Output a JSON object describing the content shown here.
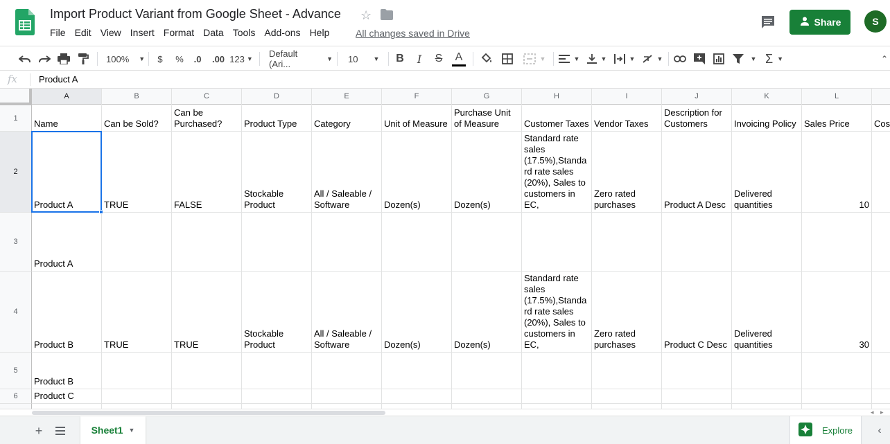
{
  "doc": {
    "title": "Import Product Variant from Google Sheet - Advance",
    "saved_status": "All changes saved in Drive"
  },
  "menus": [
    "File",
    "Edit",
    "View",
    "Insert",
    "Format",
    "Data",
    "Tools",
    "Add-ons",
    "Help"
  ],
  "header": {
    "share_label": "Share",
    "avatar_letter": "S"
  },
  "toolbar": {
    "zoom": "100%",
    "currency": "$",
    "percent": "%",
    "decimal_decrease": ".0",
    "decimal_increase": ".00",
    "more_formats": "123",
    "font": "Default (Ari...",
    "font_size": "10"
  },
  "formula_bar": {
    "fx": "fx",
    "value": "Product A"
  },
  "columns": [
    "A",
    "B",
    "C",
    "D",
    "E",
    "F",
    "G",
    "H",
    "I",
    "J",
    "K",
    "L"
  ],
  "rows": [
    "1",
    "2",
    "3",
    "4",
    "5",
    "6"
  ],
  "cells": [
    [
      "Name",
      "Can be Sold?",
      "Can be Purchased?",
      "Product Type",
      "Category",
      "Unit of Measure",
      "Purchase Unit of Measure",
      "Customer Taxes",
      "Vendor Taxes",
      "Description for Customers",
      "Invoicing Policy",
      "Sales Price",
      "Cos"
    ],
    [
      "Product A",
      "TRUE",
      "FALSE",
      "Stockable Product",
      "All / Saleable / Software",
      "Dozen(s)",
      "Dozen(s)",
      "Standard rate sales (17.5%),Standard rate sales (20%), Sales to customers in EC,",
      "Zero rated purchases",
      "Product A Desc",
      "Delivered quantities",
      "10",
      ""
    ],
    [
      "Product A",
      "",
      "",
      "",
      "",
      "",
      "",
      "",
      "",
      "",
      "",
      "",
      ""
    ],
    [
      "Product B",
      "TRUE",
      "TRUE",
      "Stockable Product",
      "All / Saleable / Software",
      "Dozen(s)",
      "Dozen(s)",
      "Standard rate sales (17.5%),Standard rate sales (20%), Sales to customers in EC,",
      "Zero rated purchases",
      "Product C Desc",
      "Delivered quantities",
      "30",
      ""
    ],
    [
      "Product B",
      "",
      "",
      "",
      "",
      "",
      "",
      "",
      "",
      "",
      "",
      "",
      ""
    ],
    [
      "Product C",
      "",
      "",
      "",
      "",
      "",
      "",
      "",
      "",
      "",
      "",
      "",
      ""
    ]
  ],
  "bottom": {
    "sheet_name": "Sheet1",
    "explore_label": "Explore"
  },
  "colors": {
    "brand_green": "#188038",
    "selection_blue": "#1a73e8"
  }
}
